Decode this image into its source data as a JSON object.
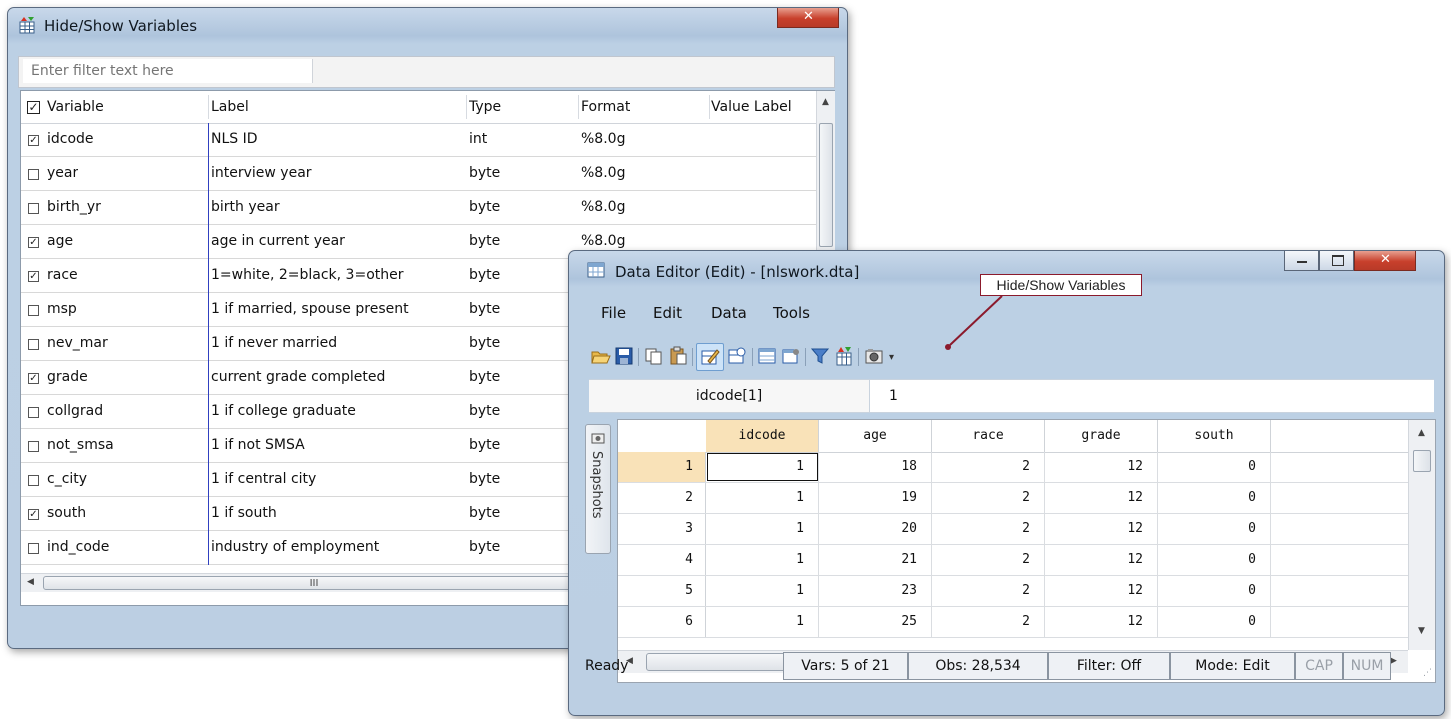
{
  "hide_show_window": {
    "title": "Hide/Show Variables",
    "filter_placeholder": "Enter filter text here",
    "columns": [
      "Variable",
      "Label",
      "Type",
      "Format",
      "Value Label"
    ],
    "header_checked": true,
    "rows": [
      {
        "checked": true,
        "variable": "idcode",
        "label": "NLS ID",
        "type": "int",
        "format": "%8.0g"
      },
      {
        "checked": false,
        "variable": "year",
        "label": "interview year",
        "type": "byte",
        "format": "%8.0g"
      },
      {
        "checked": false,
        "variable": "birth_yr",
        "label": "birth year",
        "type": "byte",
        "format": "%8.0g"
      },
      {
        "checked": true,
        "variable": "age",
        "label": "age in current year",
        "type": "byte",
        "format": "%8.0g"
      },
      {
        "checked": true,
        "variable": "race",
        "label": "1=white, 2=black, 3=other",
        "type": "byte",
        "format": ""
      },
      {
        "checked": false,
        "variable": "msp",
        "label": "1 if married, spouse present",
        "type": "byte",
        "format": ""
      },
      {
        "checked": false,
        "variable": "nev_mar",
        "label": "1 if never married",
        "type": "byte",
        "format": ""
      },
      {
        "checked": true,
        "variable": "grade",
        "label": "current grade completed",
        "type": "byte",
        "format": ""
      },
      {
        "checked": false,
        "variable": "collgrad",
        "label": "1 if college graduate",
        "type": "byte",
        "format": ""
      },
      {
        "checked": false,
        "variable": "not_smsa",
        "label": "1 if not SMSA",
        "type": "byte",
        "format": ""
      },
      {
        "checked": false,
        "variable": "c_city",
        "label": "1 if central city",
        "type": "byte",
        "format": ""
      },
      {
        "checked": true,
        "variable": "south",
        "label": "1 if south",
        "type": "byte",
        "format": ""
      },
      {
        "checked": false,
        "variable": "ind_code",
        "label": "industry of employment",
        "type": "byte",
        "format": ""
      }
    ],
    "hscroll_grip": "III"
  },
  "data_editor": {
    "title": "Data Editor (Edit) - [nlswork.dta]",
    "menu": [
      "File",
      "Edit",
      "Data",
      "Tools"
    ],
    "toolbar_icons": [
      "open-icon",
      "save-icon",
      "copy-icon",
      "paste-icon",
      "edit-mode-icon",
      "browse-mode-icon",
      "variables-window-icon",
      "properties-window-icon",
      "filter-icon",
      "hide-show-variables-icon",
      "snapshot-icon",
      "toolbar-more-icon"
    ],
    "cell_name": "idcode[1]",
    "cell_value": "1",
    "snapshots_tab": "Snapshots",
    "columns": [
      "idcode",
      "age",
      "race",
      "grade",
      "south"
    ],
    "rows": [
      {
        "n": "1",
        "values": [
          "1",
          "18",
          "2",
          "12",
          "0"
        ]
      },
      {
        "n": "2",
        "values": [
          "1",
          "19",
          "2",
          "12",
          "0"
        ]
      },
      {
        "n": "3",
        "values": [
          "1",
          "20",
          "2",
          "12",
          "0"
        ]
      },
      {
        "n": "4",
        "values": [
          "1",
          "21",
          "2",
          "12",
          "0"
        ]
      },
      {
        "n": "5",
        "values": [
          "1",
          "23",
          "2",
          "12",
          "0"
        ]
      },
      {
        "n": "6",
        "values": [
          "1",
          "25",
          "2",
          "12",
          "0"
        ]
      }
    ],
    "hscroll_grip": "III",
    "status": {
      "ready": "Ready",
      "vars": "Vars: 5 of 21",
      "obs": "Obs: 28,534",
      "filter": "Filter: Off",
      "mode": "Mode: Edit",
      "cap": "CAP",
      "num": "NUM"
    }
  },
  "callout": {
    "text": "Hide/Show Variables",
    "border_color": "#8b1a2c"
  },
  "colors": {
    "selected_header": "#f9e2b8",
    "grid_line": "#d8d8d8",
    "column_divider": "#3040c0"
  }
}
